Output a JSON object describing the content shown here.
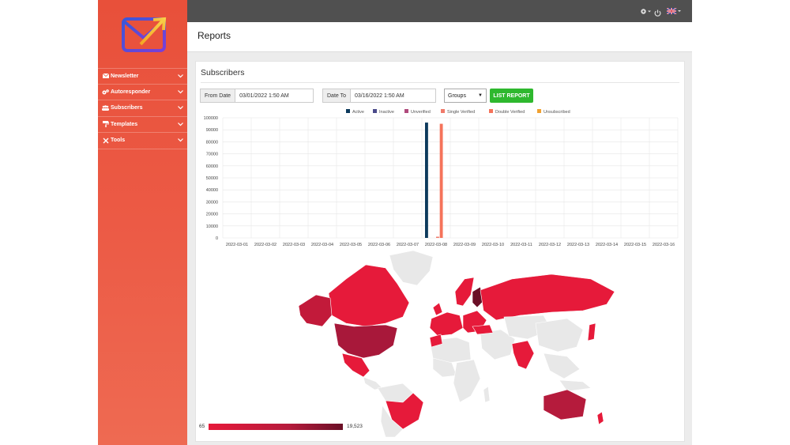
{
  "colors": {
    "sidebar": "#e8503a",
    "topbar": "#505050",
    "accent_button": "#2eb82e"
  },
  "sidebar": {
    "logo_icon": "envelope-arrow-logo",
    "items": [
      {
        "label": "Newsletter",
        "icon": "envelope-icon"
      },
      {
        "label": "Autoresponder",
        "icon": "gears-icon"
      },
      {
        "label": "Subscribers",
        "icon": "users-icon"
      },
      {
        "label": "Templates",
        "icon": "paint-roller-icon"
      },
      {
        "label": "Tools",
        "icon": "tools-icon"
      }
    ]
  },
  "topbar": {
    "settings_icon": "gear-icon",
    "power_icon": "power-icon",
    "language_icon": "uk-flag-icon"
  },
  "page": {
    "title": "Reports"
  },
  "panel": {
    "title": "Subscribers",
    "from_date": {
      "label": "From Date",
      "value": "03/01/2022 1:50 AM"
    },
    "date_to": {
      "label": "Date To",
      "value": "03/16/2022 1:50 AM"
    },
    "groups_select": "Groups",
    "list_report_label": "LIST REPORT"
  },
  "chart_data": {
    "type": "bar",
    "categories": [
      "2022-03-01",
      "2022-03-02",
      "2022-03-03",
      "2022-03-04",
      "2022-03-05",
      "2022-03-06",
      "2022-03-07",
      "2022-03-08",
      "2022-03-09",
      "2022-03-10",
      "2022-03-11",
      "2022-03-12",
      "2022-03-13",
      "2022-03-14",
      "2022-03-15",
      "2022-03-16"
    ],
    "series": [
      {
        "name": "Active",
        "color": "#0d3a5c",
        "values": [
          0,
          0,
          0,
          0,
          0,
          0,
          0,
          96000,
          0,
          0,
          0,
          0,
          0,
          0,
          0,
          0
        ]
      },
      {
        "name": "Inactive",
        "color": "#4a4a8a",
        "values": [
          0,
          0,
          0,
          0,
          0,
          0,
          0,
          0,
          0,
          0,
          0,
          0,
          0,
          0,
          0,
          0
        ]
      },
      {
        "name": "Unverified",
        "color": "#b04a7c",
        "values": [
          0,
          0,
          0,
          0,
          0,
          0,
          0,
          0,
          0,
          0,
          0,
          0,
          0,
          0,
          0,
          0
        ]
      },
      {
        "name": "Single Verified",
        "color": "#f07a6a",
        "values": [
          0,
          0,
          0,
          0,
          0,
          0,
          0,
          1000,
          0,
          0,
          0,
          0,
          0,
          0,
          0,
          0
        ]
      },
      {
        "name": "Double Verified",
        "color": "#f5735a",
        "values": [
          0,
          0,
          0,
          0,
          0,
          0,
          0,
          95000,
          0,
          0,
          0,
          0,
          0,
          0,
          0,
          0
        ]
      },
      {
        "name": "Unsubscribed",
        "color": "#f0a030",
        "values": [
          0,
          0,
          0,
          0,
          0,
          0,
          0,
          0,
          0,
          0,
          0,
          0,
          0,
          0,
          0,
          0
        ]
      }
    ],
    "yticks": [
      "100000",
      "90000",
      "80000",
      "70000",
      "60000",
      "50000",
      "40000",
      "30000",
      "20000",
      "10000",
      "0"
    ],
    "ylim": [
      0,
      100000
    ],
    "legend": "top",
    "grid": true
  },
  "map": {
    "legend_min": "65",
    "legend_max": "19,523",
    "colors": {
      "low": "#e61a3a",
      "mid": "#b51b3c",
      "high": "#6a0f26",
      "none": "#e8e8e8"
    }
  }
}
